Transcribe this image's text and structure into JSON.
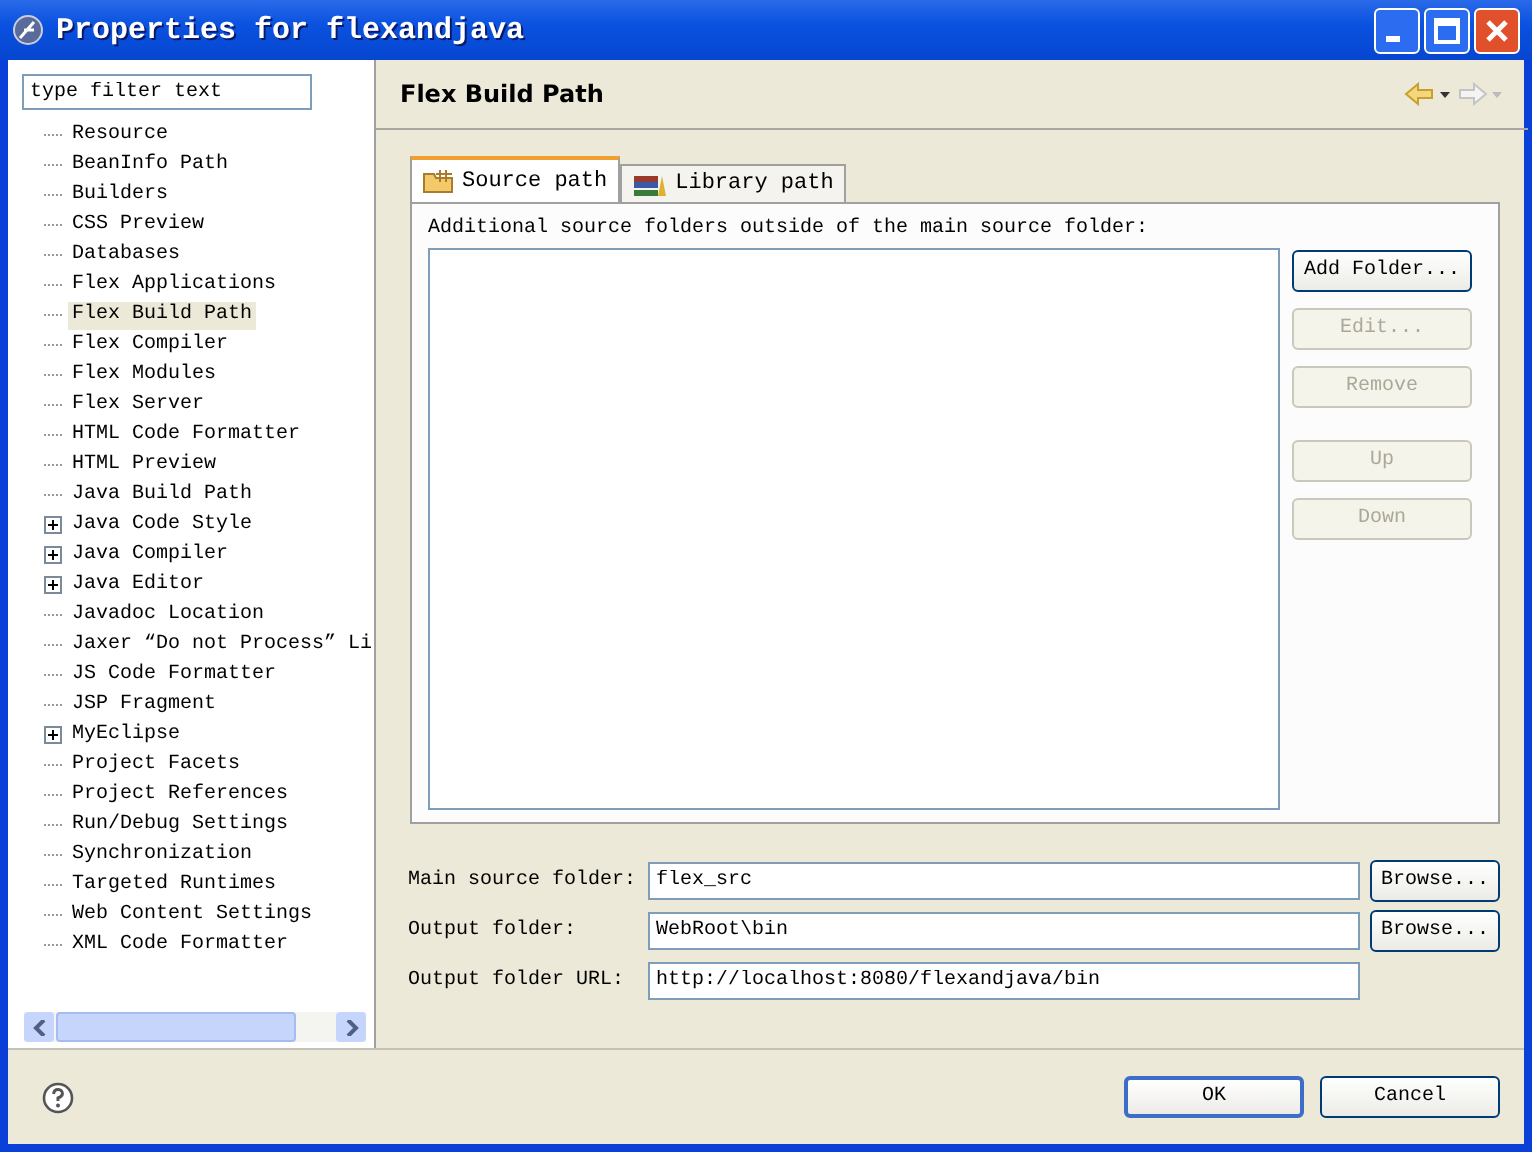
{
  "window": {
    "title": "Properties for flexandjava"
  },
  "filter": {
    "placeholder": "type filter text"
  },
  "tree": [
    {
      "label": "Resource",
      "kind": "leaf",
      "selected": false
    },
    {
      "label": "BeanInfo Path",
      "kind": "leaf",
      "selected": false
    },
    {
      "label": "Builders",
      "kind": "leaf",
      "selected": false
    },
    {
      "label": "CSS Preview",
      "kind": "leaf",
      "selected": false
    },
    {
      "label": "Databases",
      "kind": "leaf",
      "selected": false
    },
    {
      "label": "Flex Applications",
      "kind": "leaf",
      "selected": false
    },
    {
      "label": "Flex Build Path",
      "kind": "leaf",
      "selected": true
    },
    {
      "label": "Flex Compiler",
      "kind": "leaf",
      "selected": false
    },
    {
      "label": "Flex Modules",
      "kind": "leaf",
      "selected": false
    },
    {
      "label": "Flex Server",
      "kind": "leaf",
      "selected": false
    },
    {
      "label": "HTML Code Formatter",
      "kind": "leaf",
      "selected": false
    },
    {
      "label": "HTML Preview",
      "kind": "leaf",
      "selected": false
    },
    {
      "label": "Java Build Path",
      "kind": "leaf",
      "selected": false
    },
    {
      "label": "Java Code Style",
      "kind": "group",
      "selected": false
    },
    {
      "label": "Java Compiler",
      "kind": "group",
      "selected": false
    },
    {
      "label": "Java Editor",
      "kind": "group",
      "selected": false
    },
    {
      "label": "Javadoc Location",
      "kind": "leaf",
      "selected": false
    },
    {
      "label": "Jaxer “Do not Process” Li",
      "kind": "leaf",
      "selected": false
    },
    {
      "label": "JS Code Formatter",
      "kind": "leaf",
      "selected": false
    },
    {
      "label": "JSP Fragment",
      "kind": "leaf",
      "selected": false
    },
    {
      "label": "MyEclipse",
      "kind": "group",
      "selected": false
    },
    {
      "label": "Project Facets",
      "kind": "leaf",
      "selected": false
    },
    {
      "label": "Project References",
      "kind": "leaf",
      "selected": false
    },
    {
      "label": "Run/Debug Settings",
      "kind": "leaf",
      "selected": false
    },
    {
      "label": "Synchronization",
      "kind": "leaf",
      "selected": false
    },
    {
      "label": "Targeted Runtimes",
      "kind": "leaf",
      "selected": false
    },
    {
      "label": "Web Content Settings",
      "kind": "leaf",
      "selected": false
    },
    {
      "label": "XML Code Formatter",
      "kind": "leaf",
      "selected": false
    }
  ],
  "page": {
    "title": "Flex Build Path",
    "tabs": [
      {
        "label": "Source path",
        "kind": "source",
        "selected": true
      },
      {
        "label": "Library path",
        "kind": "library",
        "selected": false
      }
    ],
    "description": "Additional source folders outside of the main source folder:",
    "side_buttons": [
      {
        "label": "Add Folder...",
        "disabled": false
      },
      {
        "label": "Edit...",
        "disabled": true
      },
      {
        "label": "Remove",
        "disabled": true
      },
      {
        "label": "Up",
        "disabled": true
      },
      {
        "label": "Down",
        "disabled": true
      }
    ],
    "fields": [
      {
        "label": "Main source folder:",
        "value": "flex_src",
        "button": "Browse..."
      },
      {
        "label": "Output folder:",
        "value": "WebRoot\\bin",
        "button": "Browse..."
      },
      {
        "label": "Output folder URL:",
        "value": "http://localhost:8080/flexandjava/bin"
      }
    ]
  },
  "buttons": [
    {
      "label": "OK",
      "default": true
    },
    {
      "label": "Cancel",
      "default": false
    }
  ]
}
